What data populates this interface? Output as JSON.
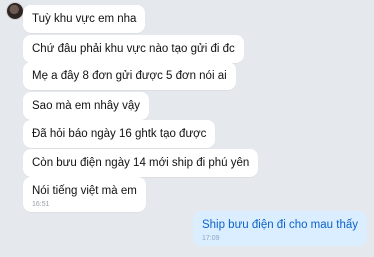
{
  "conversation": {
    "incoming": [
      {
        "text": "Tuỳ khu vực em nha"
      },
      {
        "text": "Chứ đâu phải khu vực nào tạo gửi đi đc"
      },
      {
        "text": "Mẹ a đây 8 đơn gửi được 5 đơn nói ai"
      },
      {
        "text": "Sao mà em nhây vậy"
      },
      {
        "text": "Đã hỏi báo ngày 16 ghtk tạo được"
      },
      {
        "text": "Còn bưu điện ngày 14 mới ship đi phú yên"
      },
      {
        "text": "Nói tiếng việt mà em",
        "time": "16:51"
      }
    ],
    "outgoing": [
      {
        "text": "Ship bưu điện đi cho mau thấy",
        "time": "17:09"
      }
    ]
  }
}
